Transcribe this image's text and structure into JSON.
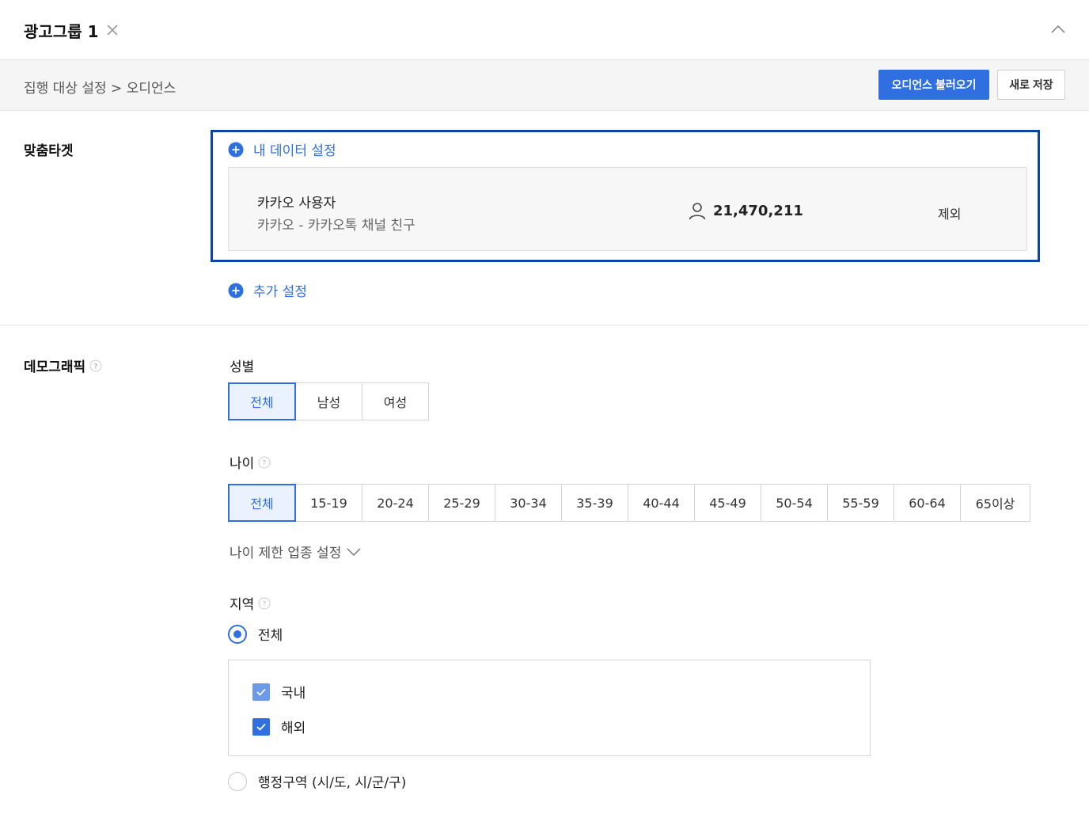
{
  "header": {
    "title": "광고그룹 1"
  },
  "breadcrumb": "집행 대상 설정 > 오디언스",
  "actions": {
    "load_audience": "오디언스 불러오기",
    "save_new": "새로 저장"
  },
  "custom_target": {
    "label": "맞춤타겟",
    "my_data_link": "내 데이터 설정",
    "card": {
      "name": "카카오 사용자",
      "sub": "카카오 - 카카오톡 채널 친구",
      "count": "21,470,211",
      "exclude": "제외"
    },
    "add_link": "추가 설정"
  },
  "demographic": {
    "label": "데모그래픽",
    "gender": {
      "label": "성별",
      "options": [
        "전체",
        "남성",
        "여성"
      ],
      "selected": "전체"
    },
    "age": {
      "label": "나이",
      "options": [
        "전체",
        "15-19",
        "20-24",
        "25-29",
        "30-34",
        "35-39",
        "40-44",
        "45-49",
        "50-54",
        "55-59",
        "60-64",
        "65이상"
      ],
      "selected": "전체",
      "restricted_link": "나이 제한 업종 설정"
    },
    "region": {
      "label": "지역",
      "all_option": "전체",
      "all_selected": true,
      "checks": [
        {
          "label": "국내",
          "checked": true
        },
        {
          "label": "해외",
          "checked": true
        }
      ],
      "admin_option": "행정구역 (시/도, 시/군/구)",
      "admin_selected": false
    }
  },
  "colors": {
    "accent": "#2f6fe0",
    "highlight_border": "#0b45a5"
  }
}
